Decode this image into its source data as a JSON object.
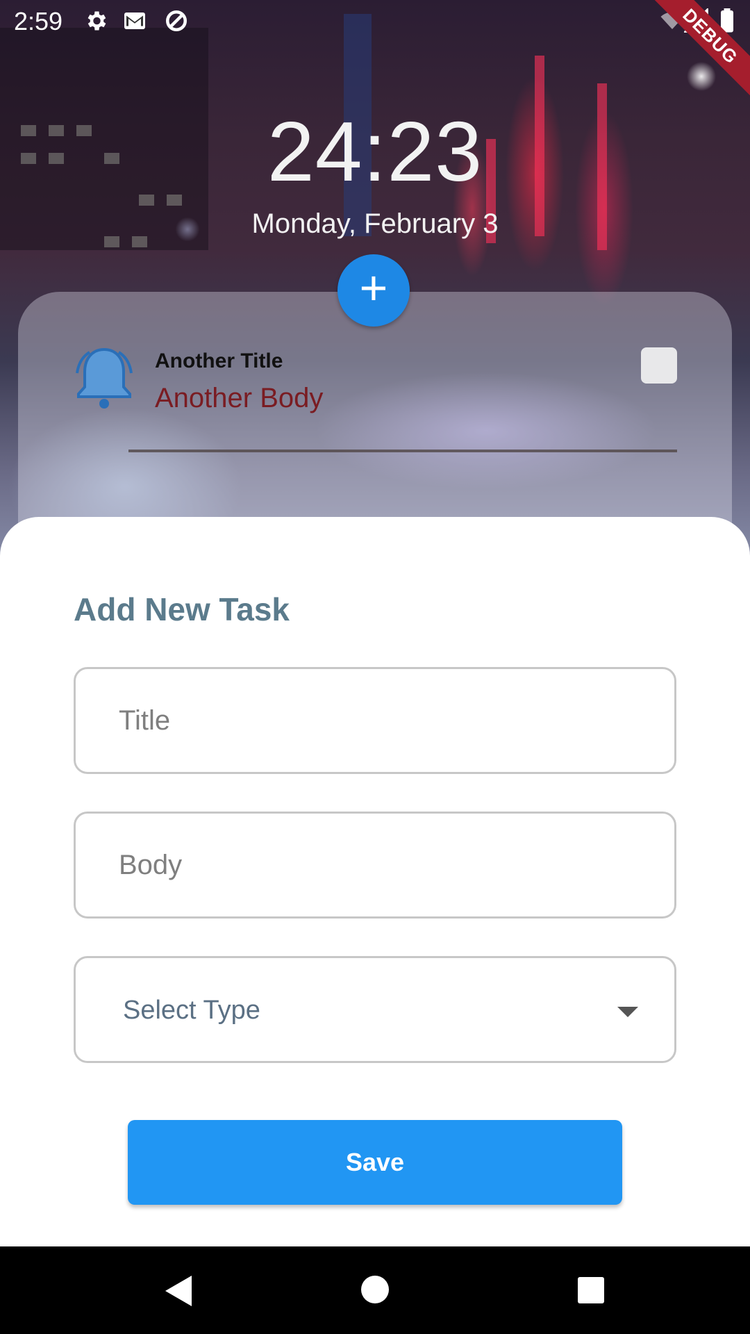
{
  "status_bar": {
    "time": "2:59",
    "icons": [
      "gear-icon",
      "gmail-icon",
      "sync-icon",
      "wifi-icon",
      "signal-icon",
      "battery-icon"
    ],
    "debug_banner": "DEBUG"
  },
  "header": {
    "clock": "24:23",
    "date": "Monday, February 3"
  },
  "add_button": {
    "label": "+"
  },
  "task_list": [
    {
      "title": "Another Title",
      "body": "Another Body",
      "icon": "bell-icon",
      "checked": false
    }
  ],
  "sheet": {
    "title": "Add New Task",
    "title_field": {
      "placeholder": "Title",
      "value": ""
    },
    "body_field": {
      "placeholder": "Body",
      "value": ""
    },
    "type_select": {
      "label": "Select Type"
    },
    "save_label": "Save"
  },
  "colors": {
    "accent": "#2196f3",
    "fab": "#1e88e5",
    "sheet_title": "#5b7b8c",
    "task_body": "#7a1c22",
    "debug_banner": "#a51e2d"
  }
}
